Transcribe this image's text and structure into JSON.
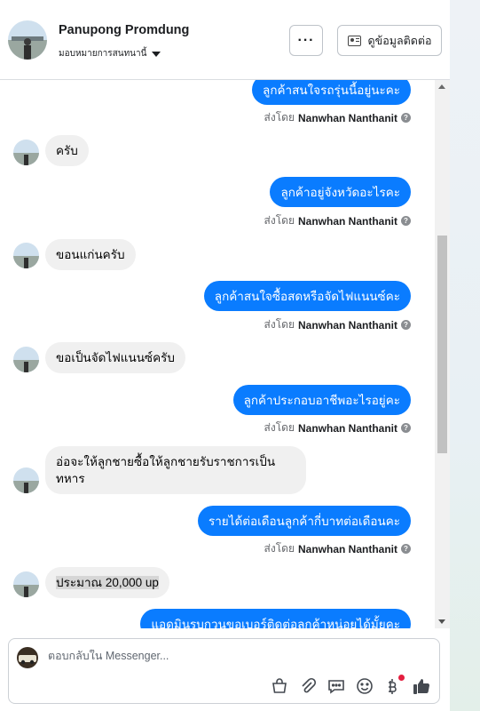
{
  "header": {
    "contact_name": "Panupong Promdung",
    "assign_label": "มอบหมายการสนทนานี้",
    "more_label": "···",
    "contact_info_label": "ดูข้อมูลติดต่อ"
  },
  "messages": [
    {
      "type": "out",
      "text": "ลูกค้าสนใจรถรุ่นนี้อยู่นะคะ",
      "sent_by_prefix": "ส่งโดย",
      "sent_by_name": "Nanwhan Nanthanit"
    },
    {
      "type": "in",
      "text": "ครับ"
    },
    {
      "type": "out",
      "text": "ลูกค้าอยู่จังหวัดอะไรคะ",
      "sent_by_prefix": "ส่งโดย",
      "sent_by_name": "Nanwhan Nanthanit"
    },
    {
      "type": "in",
      "text": "ขอนแก่นครับ"
    },
    {
      "type": "out",
      "text": "ลูกค้าสนใจซื้อสดหรือจัดไฟแนนซ์คะ",
      "sent_by_prefix": "ส่งโดย",
      "sent_by_name": "Nanwhan Nanthanit"
    },
    {
      "type": "in",
      "text": "ขอเป็นจัดไฟแนนซ์ครับ"
    },
    {
      "type": "out",
      "text": "ลูกค้าประกอบอาชีพอะไรอยู่คะ",
      "sent_by_prefix": "ส่งโดย",
      "sent_by_name": "Nanwhan Nanthanit"
    },
    {
      "type": "in",
      "text": "อ่อจะให้ลูกชายซื้อให้ลูกชายรับราชการเป็นทหาร"
    },
    {
      "type": "out",
      "text": "รายได้ต่อเดือนลูกค้ากี่บาทต่อเดือนคะ",
      "sent_by_prefix": "ส่งโดย",
      "sent_by_name": "Nanwhan Nanthanit"
    },
    {
      "type": "in",
      "text": "ประมาณ 20,000 up"
    },
    {
      "type": "out",
      "text": "แอดมินรบกวนขอเบอร์ติดต่อลูกค้าหน่อยได้มั้ยคะ"
    }
  ],
  "composer": {
    "placeholder": "ตอบกลับใน Messenger..."
  },
  "colors": {
    "outgoing_bubble": "#0a7cff",
    "incoming_bubble": "#f0f0f0",
    "like_icon": "#444950",
    "notification_dot": "#e41e3f"
  },
  "icons": [
    "shopping-bag-icon",
    "attachment-icon",
    "saved-reply-icon",
    "emoji-icon",
    "baht-icon",
    "thumbs-up-icon"
  ]
}
